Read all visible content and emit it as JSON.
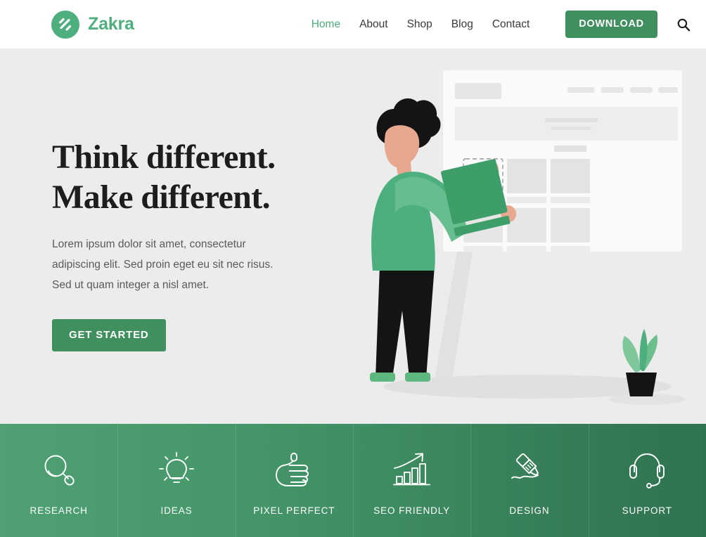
{
  "header": {
    "brand": {
      "name": "Zakra",
      "mark_icon": "zakra-logo-icon",
      "color": "#4caf7d"
    },
    "nav": [
      {
        "label": "Home",
        "active": true
      },
      {
        "label": "About",
        "active": false
      },
      {
        "label": "Shop",
        "active": false
      },
      {
        "label": "Blog",
        "active": false
      },
      {
        "label": "Contact",
        "active": false
      }
    ],
    "download_button": {
      "label": "DOWNLOAD",
      "color": "#3f8f5f"
    },
    "icons": [
      {
        "name": "search-icon"
      },
      {
        "name": "shopping-cart-icon"
      }
    ]
  },
  "hero": {
    "title_line1": "Think different.",
    "title_line2": "Make different.",
    "paragraph": "Lorem ipsum dolor sit amet, consectetur adipiscing elit. Sed proin eget eu sit nec risus. Sed ut quam integer a nisl amet.",
    "cta_button": {
      "label": "GET STARTED",
      "color": "#3f8f5f"
    },
    "background_color": "#ececec",
    "illustration": {
      "name": "person-building-website-illustration",
      "elements": [
        "wireframe-board",
        "person-placing-tile",
        "potted-plant",
        "floor-shadow"
      ],
      "colors": {
        "sweater": "#4caf7d",
        "sweater_light": "#66bd8e",
        "hair": "#141414",
        "skin": "#e8a88f",
        "pants": "#141414",
        "tile": "#3d9e6a",
        "board": "#fafafa",
        "plant_leaf": "#7dc79b"
      }
    }
  },
  "features": {
    "gradient_from": "#4fa173",
    "gradient_to": "#2f7350",
    "items": [
      {
        "label": "RESEARCH",
        "icon": "magnifier-icon"
      },
      {
        "label": "IDEAS",
        "icon": "lightbulb-icon"
      },
      {
        "label": "PIXEL PERFECT",
        "icon": "thumbs-up-icon"
      },
      {
        "label": "SEO FRIENDLY",
        "icon": "growth-chart-icon"
      },
      {
        "label": "DESIGN",
        "icon": "marker-pen-icon"
      },
      {
        "label": "SUPPORT",
        "icon": "headset-icon"
      }
    ]
  }
}
